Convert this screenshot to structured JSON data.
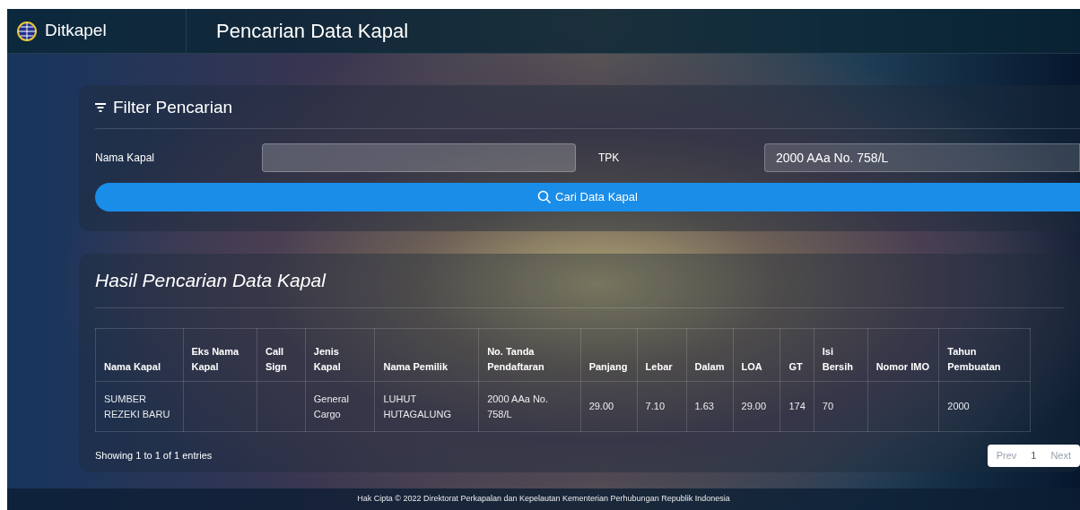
{
  "brand": {
    "name": "Ditkapel"
  },
  "page_title": "Pencarian Data Kapal",
  "filter": {
    "title": "Filter Pencarian",
    "fields": [
      {
        "label": "Nama Kapal"
      },
      {
        "label": "TPK",
        "value": "2000 AAa No. 758/L"
      }
    ],
    "button": "Cari Data Kapal"
  },
  "results": {
    "title": "Hasil Pencarian Data Kapal",
    "table": {
      "columns": [
        "Nama Kapal",
        "Eks Nama Kapal",
        "Call Sign",
        "Jenis Kapal",
        "Nama Pemilik",
        "No. Tanda Pendaftaran",
        "Panjang",
        "Lebar",
        "Dalam",
        "LOA",
        "GT",
        "Isi Bersih",
        "Nomor IMO",
        "Tahun Pembuatan"
      ],
      "rows": [
        [
          "SUMBER REZEKI BARU",
          null,
          null,
          "General Cargo",
          "LUHUT HUTAGALUNG",
          "2000 AAa No. 758/L",
          "29.00",
          "7.10",
          "1.63",
          "29.00",
          "174",
          "70",
          null,
          "2000"
        ]
      ]
    },
    "info": "Showing 1 to 1 of 1 entries",
    "pagination": {
      "prev": "Prev",
      "pages": [
        {
          "label": "1",
          "selected": true
        }
      ],
      "next": "Next"
    }
  },
  "footer": "Hak Cipta © 2022 Direktorat Perkapalan dan Kepelautan Kementerian Perhubungan Republik Indonesia"
}
